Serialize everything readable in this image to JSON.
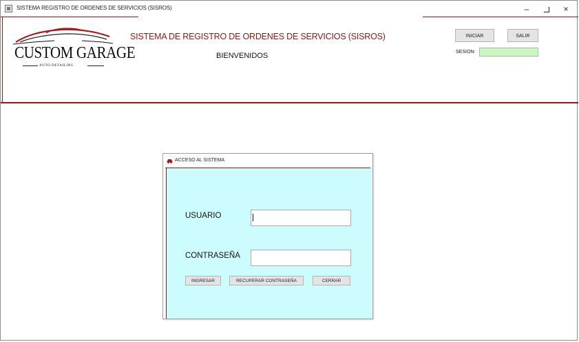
{
  "window": {
    "title": "SISTEMA REGISTRO DE ORDENES DE SERVICIOS (SISROS)",
    "controls": {
      "minimize": "–",
      "close": "×"
    }
  },
  "header": {
    "logo_main": "CUSTOM GARAGE",
    "logo_sub": "AUTO DETAILING",
    "app_title": "SISTEMA DE REGISTRO DE ORDENES DE SERVICIOS (SISROS)",
    "welcome": "BIENVENIDOS",
    "iniciar_label": "INICIAR",
    "salir_label": "SALIR",
    "session_label": "SESION:",
    "session_value": ""
  },
  "dialog": {
    "title": "ACCESO AL SISTEMA",
    "user_label": "USUARIO",
    "user_value": "",
    "password_label": "CONTRASEÑA",
    "password_value": "",
    "buttons": {
      "ingresar": "INGRESAR",
      "recuperar": "RECUPERAR CONTRASEÑA",
      "cerrar": "CERRAR"
    }
  },
  "colors": {
    "accent": "#8b1a1a",
    "dialog_bg": "#ccfcfd",
    "session_field_bg": "#cdf5c3",
    "button_bg": "#e4e4e4"
  }
}
